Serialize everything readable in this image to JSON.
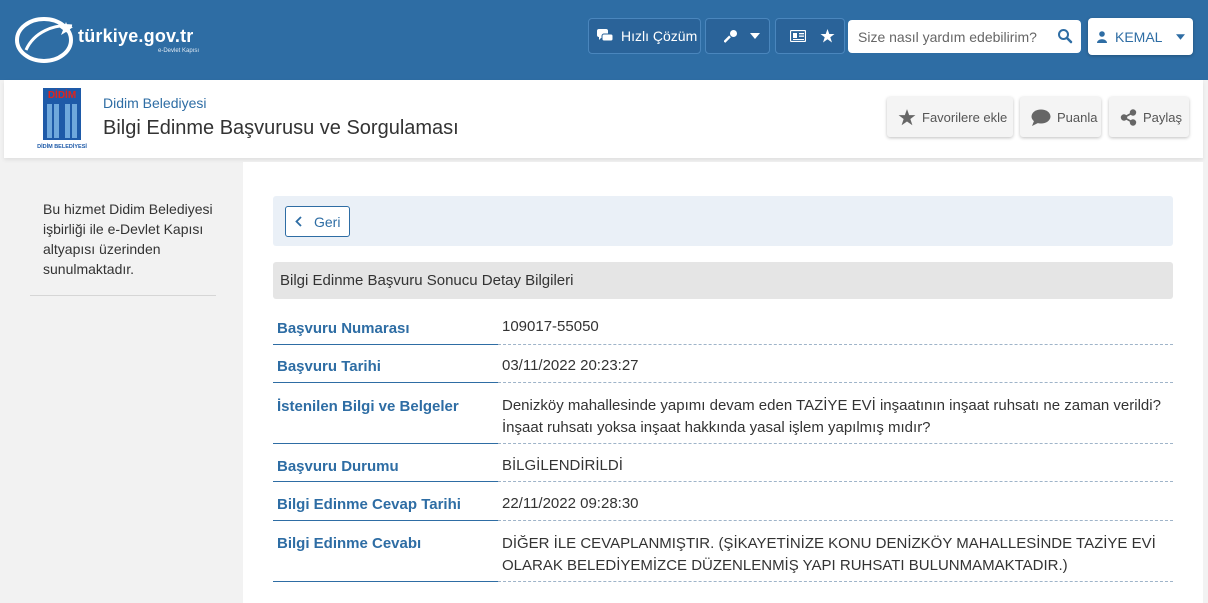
{
  "topbar": {
    "brand": "türkiye.gov.tr",
    "brand_sub": "e-Devlet Kapısı",
    "quick_solution_label": "Hızlı Çözüm",
    "search_placeholder": "Size nasıl yardım edebilirim?",
    "user_name": "KEMAL",
    "bg_color": "#2e6da4"
  },
  "header": {
    "institution_name": "Didim Belediyesi",
    "page_title": "Bilgi Edinme Başvurusu ve Sorgulaması",
    "logo_text_top": "DİDİM",
    "logo_text_bottom": "DİDİM BELEDİYESİ",
    "favorite_label": "Favorilere ekle",
    "rate_label": "Puanla",
    "share_label": "Paylaş"
  },
  "sidebar": {
    "info_text": "Bu hizmet Didim Belediyesi işbirliği ile e-Devlet Kapısı altyapısı üzerinden sunulmaktadır."
  },
  "main": {
    "back_label": "Geri",
    "section_title": "Bilgi Edinme Başvuru Sonucu Detay Bilgileri",
    "rows": [
      {
        "label": "Başvuru Numarası",
        "value": "109017-55050"
      },
      {
        "label": "Başvuru Tarihi",
        "value": "03/11/2022 20:23:27"
      },
      {
        "label": "İstenilen Bilgi ve Belgeler",
        "value": "Denizköy mahallesinde yapımı devam eden TAZİYE EVİ inşaatının inşaat ruhsatı ne zaman verildi? İnşaat ruhsatı yoksa inşaat hakkında yasal işlem yapılmış mıdır?"
      },
      {
        "label": "Başvuru Durumu",
        "value": "BİLGİLENDİRİLDİ"
      },
      {
        "label": "Bilgi Edinme Cevap Tarihi",
        "value": "22/11/2022 09:28:30"
      },
      {
        "label": "Bilgi Edinme Cevabı",
        "value": "DİĞER İLE CEVAPLANMIŞTIR. (ŞİKAYETİNİZE KONU DENİZKÖY MAHALLESİNDE TAZİYE EVİ OLARAK BELEDİYEMİZCE DÜZENLENMİŞ YAPI RUHSATI BULUNMAMAKTADIR.)"
      }
    ]
  }
}
